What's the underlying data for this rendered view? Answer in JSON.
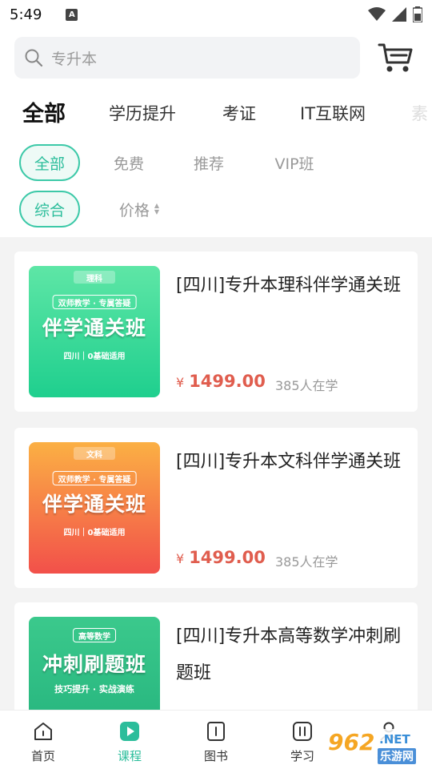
{
  "status_bar": {
    "time": "5:49",
    "notification": "A"
  },
  "search": {
    "placeholder": "专升本"
  },
  "category_tabs": [
    {
      "label": "全部",
      "active": true
    },
    {
      "label": "学历提升",
      "active": false
    },
    {
      "label": "考证",
      "active": false
    },
    {
      "label": "IT互联网",
      "active": false
    },
    {
      "label": "素",
      "active": false
    }
  ],
  "filters": {
    "type": [
      {
        "label": "全部",
        "active": true
      },
      {
        "label": "免费",
        "active": false
      },
      {
        "label": "推荐",
        "active": false
      },
      {
        "label": "VIP班",
        "active": false
      }
    ],
    "sort": [
      {
        "label": "综合",
        "active": true
      },
      {
        "label": "价格",
        "active": false
      }
    ]
  },
  "courses": [
    {
      "title": "[四川]专升本理科伴学通关班",
      "price": "1499.00",
      "currency": "¥",
      "students": "385人在学",
      "thumb": {
        "tag": "理科",
        "badge": "双师教学 · 专属答疑",
        "big": "伴学通关班",
        "sub": "四川｜0基础适用",
        "color_top": "#5ee6a6",
        "color_bottom": "#1fcf8e"
      }
    },
    {
      "title": "[四川]专升本文科伴学通关班",
      "price": "1499.00",
      "currency": "¥",
      "students": "385人在学",
      "thumb": {
        "tag": "文科",
        "badge": "双师教学 · 专属答疑",
        "big": "伴学通关班",
        "sub": "四川｜0基础适用",
        "color_top": "#fbb044",
        "color_bottom": "#f2504a"
      }
    },
    {
      "title": "[四川]专升本高等数学冲刺刷题班",
      "price": "",
      "currency": "",
      "students": "",
      "thumb": {
        "tag": "",
        "badge": "高等数学",
        "big": "冲刺刷题班",
        "sub": "技巧提升 · 实战演练",
        "color_top": "#3bc98c",
        "color_bottom": "#23b27c"
      }
    }
  ],
  "bottom_nav": [
    {
      "label": "首页",
      "icon": "home-icon",
      "active": false
    },
    {
      "label": "课程",
      "icon": "play-icon",
      "active": true
    },
    {
      "label": "图书",
      "icon": "book-icon",
      "active": false
    },
    {
      "label": "学习",
      "icon": "study-icon",
      "active": false
    },
    {
      "label": "我的",
      "icon": "user-icon",
      "active": false
    }
  ],
  "watermark": {
    "num": "962",
    "net": ".NET",
    "cn": "乐游网"
  },
  "colors": {
    "accent": "#2bbd9b",
    "price": "#e05d4e"
  }
}
